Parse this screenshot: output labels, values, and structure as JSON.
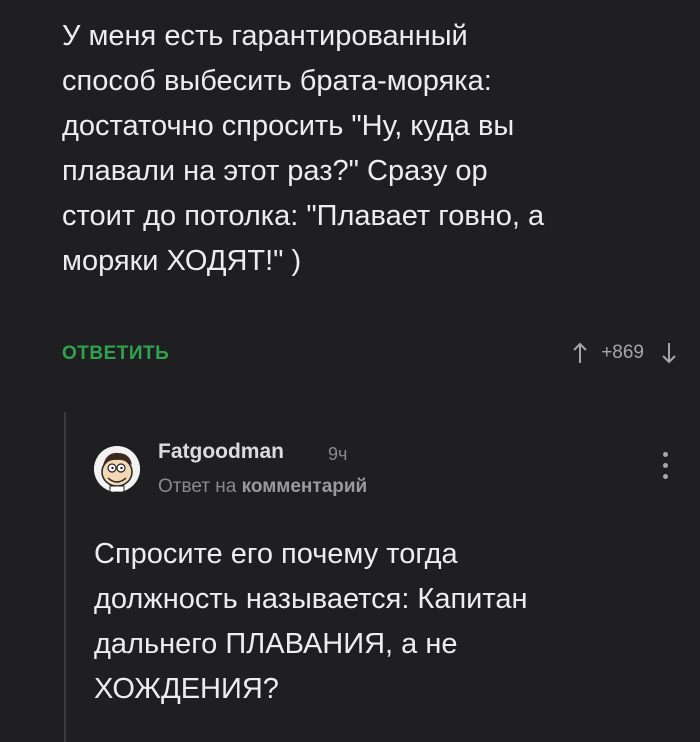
{
  "main_comment": {
    "text": "У меня есть гарантированный\nспособ выбесить брата-моряка:\nдостаточно спросить \"Ну, куда вы\nплавали на этот раз?\" Сразу ор\nстоит до потолка: \"Плавает говно, а\nморяки ХОДЯТ!\" )",
    "reply_label": "ОТВЕТИТЬ",
    "rating": "+869",
    "upvote_icon": "arrow-up-icon",
    "downvote_icon": "arrow-down-icon"
  },
  "reply": {
    "author": "Fatgoodman",
    "time": "9ч",
    "meta_prefix": "Ответ на",
    "meta_target": "комментарий",
    "text": "Спросите его почему тогда\nдолжность называется: Капитан\nдальнего ПЛАВАНИЯ, а не\nХОЖДЕНИЯ?",
    "avatar_icon": "cartoon-avatar-icon",
    "menu_icon": "more-vertical-icon"
  },
  "colors": {
    "background": "#1f1f22",
    "text": "#ededed",
    "accent": "#2fa24d",
    "muted": "#8a8a8a"
  }
}
